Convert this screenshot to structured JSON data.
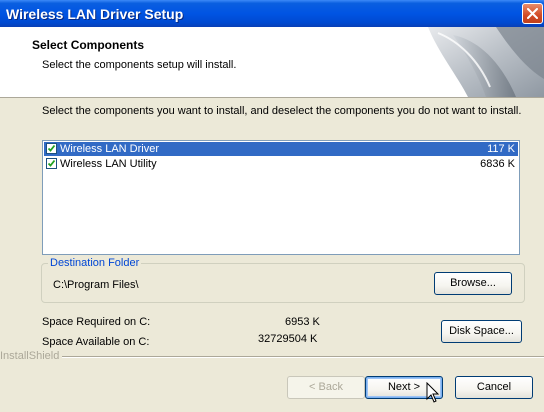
{
  "window": {
    "title": "Wireless LAN Driver Setup",
    "close_icon": "close-icon"
  },
  "header": {
    "title": "Select Components",
    "subtitle": "Select the components setup will install."
  },
  "instructions": "Select the components you want to install, and deselect the components you do not want to install.",
  "components": [
    {
      "name": "Wireless LAN Driver",
      "size": "117 K",
      "checked": true,
      "selected": true
    },
    {
      "name": "Wireless LAN Utility",
      "size": "6836 K",
      "checked": true,
      "selected": false
    }
  ],
  "destination": {
    "legend": "Destination Folder",
    "path": "C:\\Program Files\\",
    "browse_label": "Browse..."
  },
  "space": {
    "required_label": "Space Required on C:",
    "required_value": "6953 K",
    "available_label": "Space Available on C:",
    "available_value": "32729504 K",
    "disk_space_label": "Disk Space..."
  },
  "brand": "InstallShield",
  "buttons": {
    "back": "< Back",
    "next": "Next >",
    "cancel": "Cancel"
  },
  "colors": {
    "title_bar": "#0054e3",
    "selection": "#316ac5",
    "legend_text": "#0046d5"
  }
}
